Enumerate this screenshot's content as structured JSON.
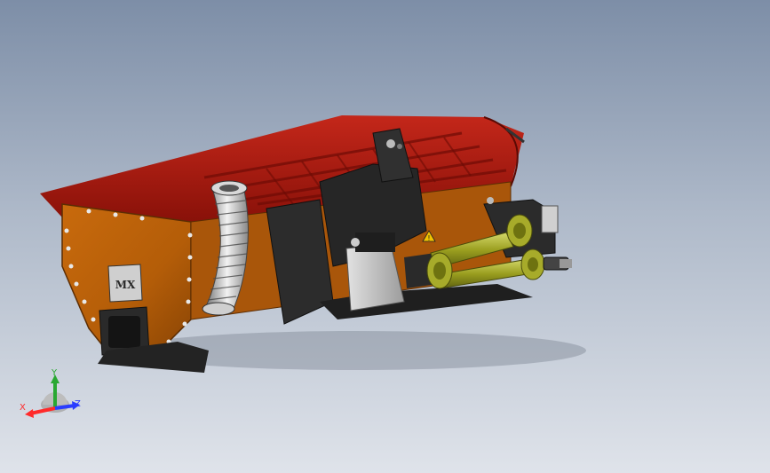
{
  "viewport": {
    "background_top": "#7d8ea7",
    "background_bottom": "#dfe3ea"
  },
  "model": {
    "hood_color": "#a4190f",
    "body_color": "#b45d08",
    "frame_color": "#2b2b2b",
    "gearbox_color": "#bdbdbd",
    "shaft_color": "#9a9e1f",
    "logo_text": "MX",
    "icons": [
      "warning-icon",
      "hose",
      "pto-shaft"
    ]
  },
  "triad": {
    "x_label": "X",
    "y_label": "Y",
    "z_label": "Z",
    "x_color": "#ff2a2a",
    "y_color": "#29a832",
    "z_color": "#2a3dff"
  }
}
